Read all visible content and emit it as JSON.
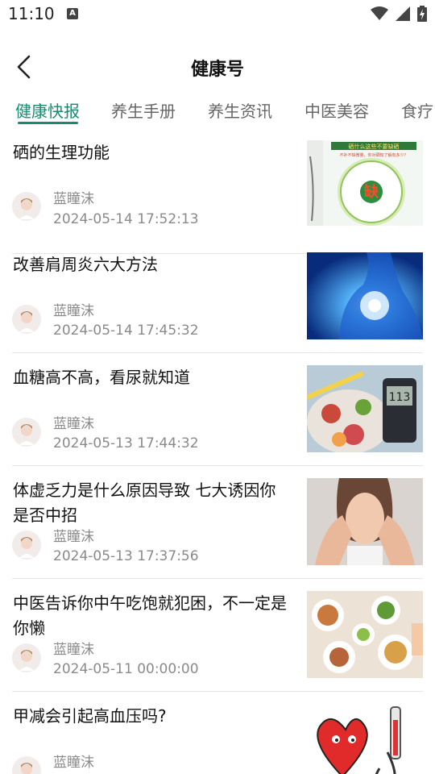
{
  "status_bar": {
    "time": "11:10",
    "notif_badge": "A"
  },
  "header": {
    "title": "健康号",
    "back_icon": "chevron-left-icon"
  },
  "tabs": [
    {
      "label": "健康快报",
      "active": true
    },
    {
      "label": "养生手册",
      "active": false
    },
    {
      "label": "养生资讯",
      "active": false
    },
    {
      "label": "中医美容",
      "active": false
    },
    {
      "label": "食疗",
      "active": false
    }
  ],
  "accent_color": "#1a8a72",
  "articles": [
    {
      "title": "硒的生理功能",
      "author": "蓝瞳沫",
      "date": "2024-05-14 17:52:13",
      "thumb_text": "缺",
      "thumb_header": "硒什么这些不要缺硒",
      "thumb_sub": "不补不缺微量，你对硒知了解有多少？"
    },
    {
      "title": "改善肩周炎六大方法",
      "author": "蓝瞳沫",
      "date": "2024-05-14 17:45:32"
    },
    {
      "title": "血糖高不高，看尿就知道",
      "author": "蓝瞳沫",
      "date": "2024-05-13 17:44:32",
      "thumb_text": "113"
    },
    {
      "title": "体虚乏力是什么原因导致 七大诱因你是否中招",
      "author": "蓝瞳沫",
      "date": "2024-05-13 17:37:56"
    },
    {
      "title": "中医告诉你中午吃饱就犯困，不一定是你懒",
      "author": "蓝瞳沫",
      "date": "2024-05-11 00:00:00"
    },
    {
      "title": "甲减会引起高血压吗?",
      "author": "蓝瞳沫",
      "date": ""
    }
  ]
}
